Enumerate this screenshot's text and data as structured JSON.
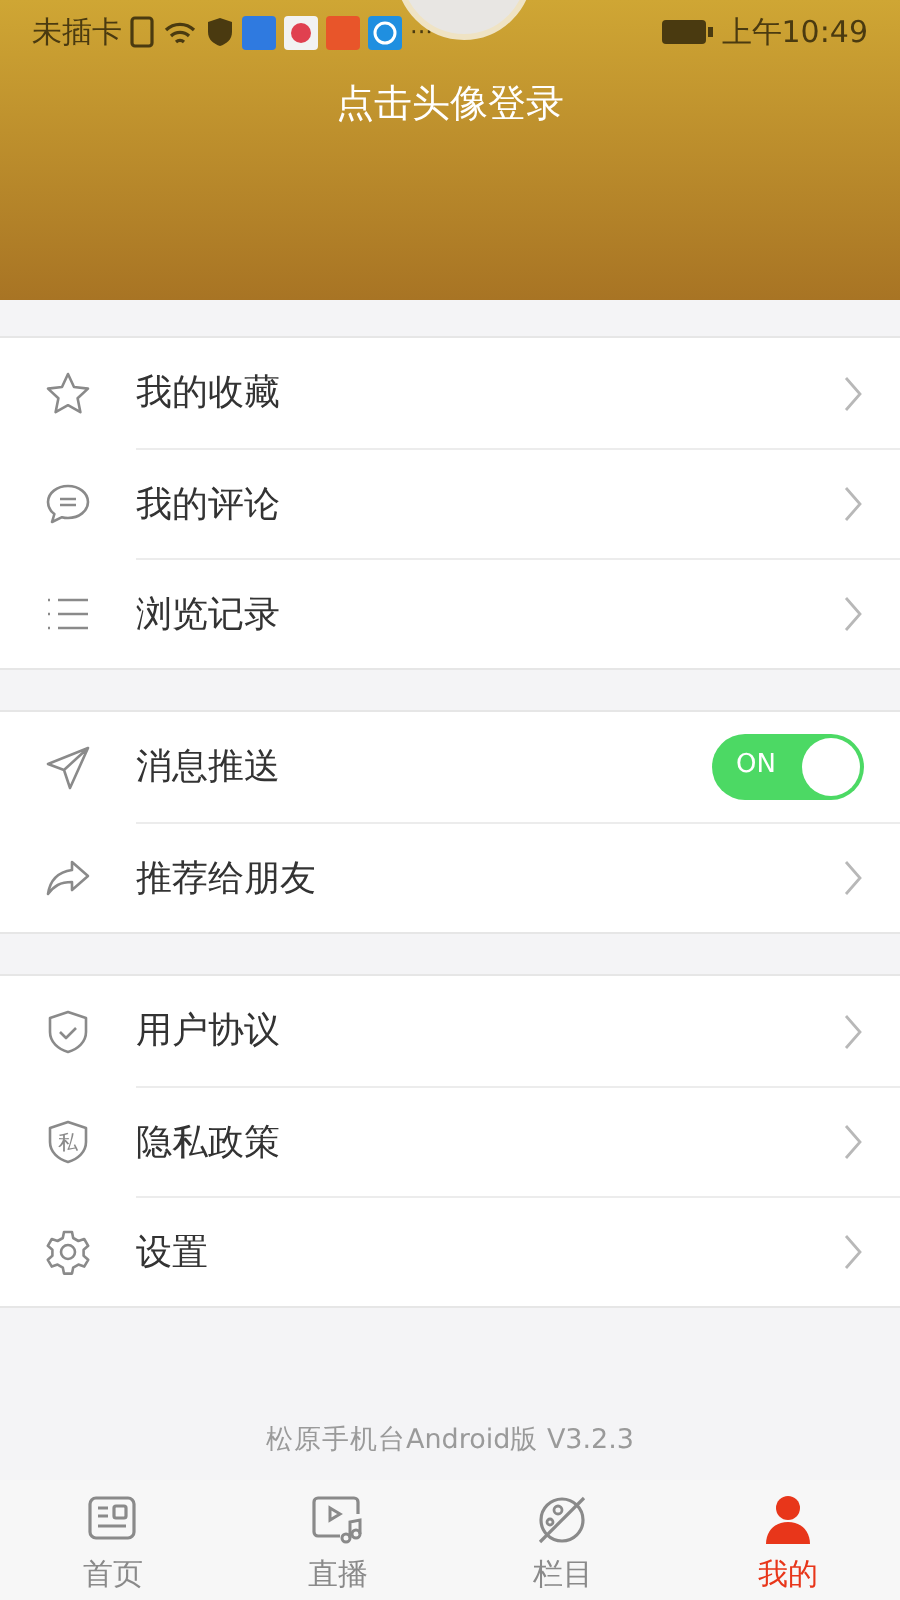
{
  "status_bar": {
    "carrier": "未插卡",
    "more": "···",
    "time": "上午10:49"
  },
  "header": {
    "login_prompt": "点击头像登录"
  },
  "groups": [
    {
      "rows": [
        {
          "kind": "link",
          "label": "我的收藏"
        },
        {
          "kind": "link",
          "label": "我的评论"
        },
        {
          "kind": "link",
          "label": "浏览记录"
        }
      ]
    },
    {
      "rows": [
        {
          "kind": "toggle",
          "label": "消息推送",
          "on": true,
          "toggle_text": "ON"
        },
        {
          "kind": "link",
          "label": "推荐给朋友"
        }
      ]
    },
    {
      "rows": [
        {
          "kind": "link",
          "label": "用户协议"
        },
        {
          "kind": "link",
          "label": "隐私政策",
          "icon_text": "私"
        },
        {
          "kind": "link",
          "label": "设置"
        }
      ]
    }
  ],
  "version": "松原手机台Android版 V3.2.3",
  "tabs": [
    {
      "label": "首页",
      "selected": false
    },
    {
      "label": "直播",
      "selected": false
    },
    {
      "label": "栏目",
      "selected": false
    },
    {
      "label": "我的",
      "selected": true
    }
  ]
}
